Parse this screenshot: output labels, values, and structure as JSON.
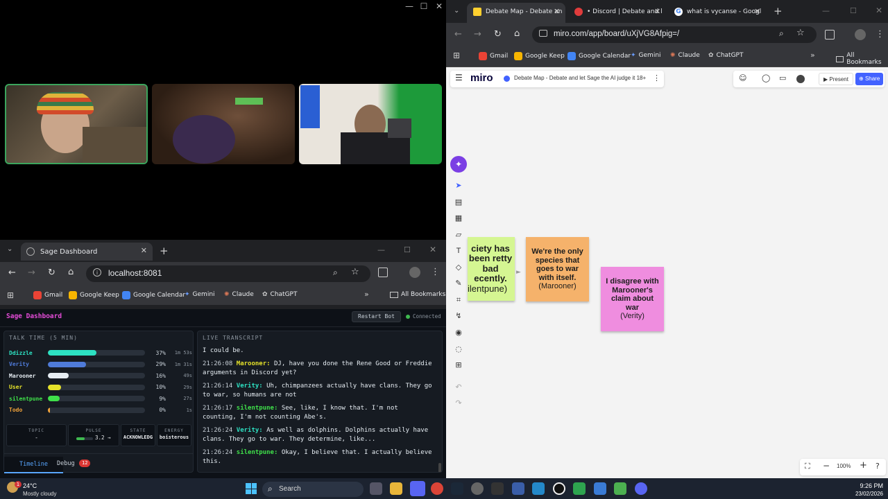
{
  "video": {
    "window_controls": [
      "—",
      "☐",
      "✕"
    ]
  },
  "sage_browser": {
    "tab_title": "Sage Dashboard",
    "url": "localhost:8081",
    "bookmarks": [
      "Gmail",
      "Google Keep",
      "Google Calendar",
      "Gemini",
      "Claude",
      "ChatGPT"
    ],
    "all_bookmarks": "All Bookmarks"
  },
  "dashboard": {
    "title": "Sage Dashboard",
    "restart_label": "Restart Bot",
    "status": "Connected",
    "talk_time_label": "TALK TIME (5 MIN)",
    "speakers": [
      {
        "name": "Ddizzle",
        "pct": "37%",
        "time": "1m 53s",
        "fraction": 0.37,
        "color": "#2de1c2"
      },
      {
        "name": "Verity",
        "pct": "29%",
        "time": "1m 31s",
        "fraction": 0.29,
        "color": "#4f7bd9"
      },
      {
        "name": "Marooner",
        "pct": "16%",
        "time": "49s",
        "fraction": 0.16,
        "color": "#e6edf3"
      },
      {
        "name": "User",
        "pct": "10%",
        "time": "29s",
        "fraction": 0.1,
        "color": "#e5e22a"
      },
      {
        "name": "silentpune",
        "pct": "9%",
        "time": "27s",
        "fraction": 0.09,
        "color": "#3fe04a"
      },
      {
        "name": "Todo",
        "pct": "0%",
        "time": "1s",
        "fraction": 0.005,
        "color": "#f2a33a"
      }
    ],
    "stats": {
      "topic_label": "TOPIC",
      "topic_value": "-",
      "pulse_label": "PULSE",
      "pulse_value": "3.2 →",
      "pulse_fraction": 0.5,
      "state_label": "STATE",
      "state_value": "ACKNOWLEDG",
      "energy_label": "ENERGY",
      "energy_value": "boisterous"
    },
    "tabs": {
      "timeline": "Timeline",
      "debug": "Debug",
      "debug_count": "12"
    },
    "transcript_label": "LIVE TRANSCRIPT",
    "transcript": [
      {
        "time": "",
        "speaker": "",
        "text": "I could be.",
        "color": "#e6edf3"
      },
      {
        "time": "21:26:08",
        "speaker": "Marooner:",
        "text": "DJ, have you done the Rene Good or Freddie arguments in Discord yet?",
        "color": "#e5e22a"
      },
      {
        "time": "21:26:14",
        "speaker": "Verity:",
        "text": "Uh, chimpanzees actually have clans. They go to war, so humans are not",
        "color": "#2de1c2"
      },
      {
        "time": "21:26:17",
        "speaker": "silentpune:",
        "text": "See, like, I know that. I'm not counting, I'm not counting Abe's.",
        "color": "#3fe04a"
      },
      {
        "time": "21:26:24",
        "speaker": "Verity:",
        "text": "As well as dolphins. Dolphins actually have clans. They go to war. They determine, like...",
        "color": "#2de1c2"
      },
      {
        "time": "21:26:24",
        "speaker": "silentpune:",
        "text": "Okay, I believe that. I actually believe this.",
        "color": "#3fe04a"
      }
    ]
  },
  "right_browser": {
    "tabs": [
      "Debate Map - Debate an",
      "• Discord | Debate and l",
      "what is vycanse - Googl"
    ],
    "url": "miro.com/app/board/uXjVG8Afpig=/",
    "bookmarks": [
      "Gmail",
      "Google Keep",
      "Google Calendar",
      "Gemini",
      "Claude",
      "ChatGPT"
    ],
    "all_bookmarks": "All Bookmarks"
  },
  "miro": {
    "logo": "miro",
    "board_title": "Debate Map - Debate and let Sage the AI judge it 18+",
    "present": "Present",
    "share": "Share",
    "zoom": "100%",
    "stickies": [
      {
        "text": "ciety has been retty bad ecently.",
        "author": "ilentpune)",
        "color": "#d5f692"
      },
      {
        "text": "We're the only species that goes to war with itself.",
        "author": "(Marooner)",
        "color": "#f5b26b"
      },
      {
        "text": "I disagree with Marooner's claim about war",
        "author": "(Verity)",
        "color": "#ef8ddf"
      }
    ]
  },
  "taskbar": {
    "weather_temp": "24°C",
    "weather_desc": "Mostly cloudy",
    "search": "Search",
    "time": "9:26 PM",
    "date": "23/02/2026"
  }
}
